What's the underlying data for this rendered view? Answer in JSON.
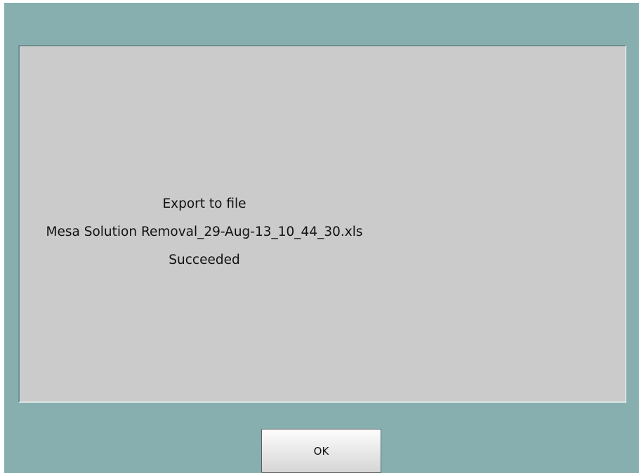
{
  "dialog": {
    "message_lines": [
      "Export to file",
      "Mesa Solution Removal_29-Aug-13_10_44_30.xls",
      "Succeeded"
    ],
    "ok_label": "OK"
  },
  "colors": {
    "dialog_background": "#87afaf",
    "message_panel_background": "#cbcbcb"
  }
}
